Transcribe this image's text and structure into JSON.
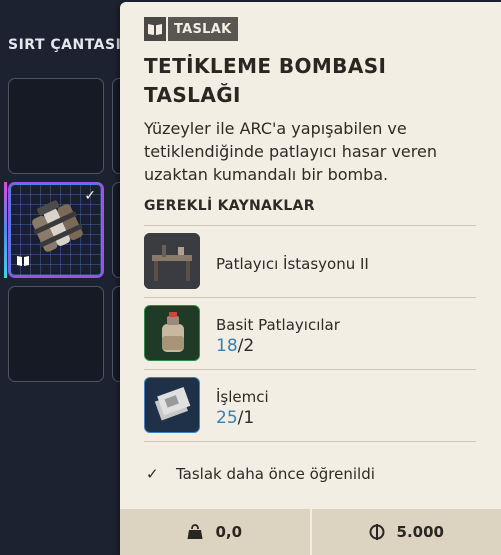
{
  "inventory": {
    "title": "SIRT ÇANTASI"
  },
  "tooltip": {
    "badge": "TASLAK",
    "title": "TETİKLEME BOMBASI TASLAĞI",
    "description": "Yüzeyler ile ARC'a yapışabilen ve tetiklendiğinde patlayıcı hasar veren uzaktan kumandalı bir bomba.",
    "section_title": "GEREKLİ KAYNAKLAR",
    "resources": [
      {
        "name": "Patlayıcı İstasyonu II",
        "have": "",
        "need": "",
        "icon": "workbench-icon"
      },
      {
        "name": "Basit Patlayıcılar",
        "have": "18",
        "need": "/2",
        "icon": "canister-icon"
      },
      {
        "name": "İşlemci",
        "have": "25",
        "need": "/1",
        "icon": "chip-icon"
      }
    ],
    "learned": "Taslak daha önce öğrenildi",
    "weight": "0,0",
    "price": "5.000"
  },
  "colors": {
    "card_bg": "#f3eee3",
    "count_have": "#3a7fb0",
    "slot_highlight": "#a050e8"
  }
}
